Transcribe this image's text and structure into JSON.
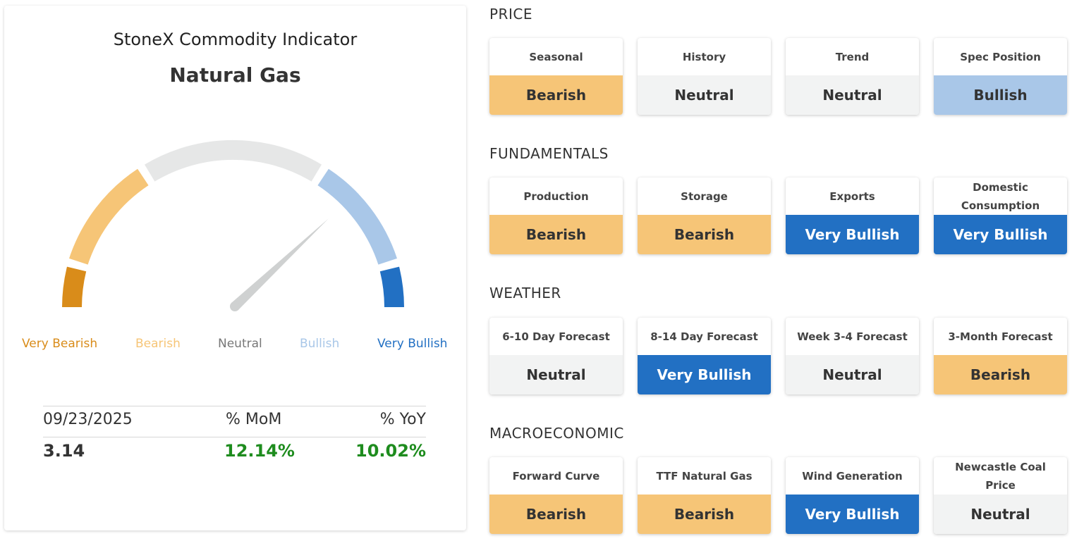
{
  "indicator": {
    "title": "StoneX Commodity Indicator",
    "commodity": "Natural Gas",
    "gauge": {
      "level": 0.76,
      "segments": [
        {
          "name": "very-bearish",
          "color": "#d98c1a"
        },
        {
          "name": "bearish",
          "color": "#f6c577"
        },
        {
          "name": "neutral",
          "color": "#e6e7e7"
        },
        {
          "name": "bullish",
          "color": "#a9c7e8"
        },
        {
          "name": "very-bullish",
          "color": "#2270c3"
        }
      ],
      "needle_color": "#cfd1d1",
      "labels": [
        {
          "text": "Very Bearish",
          "color": "#d98c1a"
        },
        {
          "text": "Bearish",
          "color": "#f6c577"
        },
        {
          "text": "Neutral",
          "color": "#777777"
        },
        {
          "text": "Bullish",
          "color": "#a9c7e8"
        },
        {
          "text": "Very Bullish",
          "color": "#2270c3"
        }
      ]
    },
    "stats": {
      "date": "09/23/2025",
      "mom_label": "% MoM",
      "yoy_label": "% YoY",
      "price": "3.14",
      "mom": "12.14%",
      "yoy": "10.02%",
      "positive_color": "#1e8c1e"
    }
  },
  "sections": [
    {
      "title": "PRICE",
      "tiles": [
        {
          "name": "Seasonal",
          "value": "Bearish"
        },
        {
          "name": "History",
          "value": "Neutral"
        },
        {
          "name": "Trend",
          "value": "Neutral"
        },
        {
          "name": "Spec Position",
          "value": "Bullish"
        }
      ]
    },
    {
      "title": "FUNDAMENTALS",
      "tiles": [
        {
          "name": "Production",
          "value": "Bearish"
        },
        {
          "name": "Storage",
          "value": "Bearish"
        },
        {
          "name": "Exports",
          "value": "Very Bullish"
        },
        {
          "name": "Domestic Consumption",
          "value": "Very Bullish"
        }
      ]
    },
    {
      "title": "WEATHER",
      "tiles": [
        {
          "name": "6-10 Day Forecast",
          "value": "Neutral"
        },
        {
          "name": "8-14 Day Forecast",
          "value": "Very Bullish"
        },
        {
          "name": "Week 3-4 Forecast",
          "value": "Neutral"
        },
        {
          "name": "3-Month Forecast",
          "value": "Bearish"
        }
      ]
    },
    {
      "title": "MACROECONOMIC",
      "tiles": [
        {
          "name": "Forward Curve",
          "value": "Bearish"
        },
        {
          "name": "TTF Natural Gas",
          "value": "Bearish"
        },
        {
          "name": "Wind Generation",
          "value": "Very Bullish"
        },
        {
          "name": "Newcastle Coal Price",
          "value": "Neutral"
        }
      ]
    }
  ]
}
